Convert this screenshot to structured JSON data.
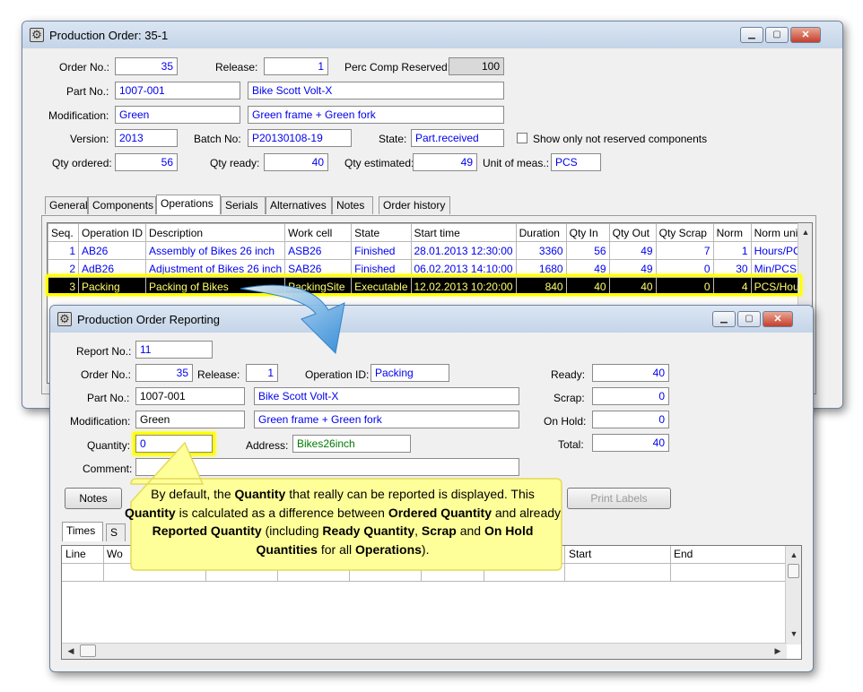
{
  "main": {
    "title": "Production Order: 35-1",
    "labels": {
      "order_no": "Order No.:",
      "release": "Release:",
      "perc_comp": "Perc Comp Reserved:",
      "part_no": "Part No.:",
      "modification": "Modification:",
      "version": "Version:",
      "batch_no": "Batch No:",
      "state": "State:",
      "show_only": "Show only not reserved components",
      "qty_ordered": "Qty ordered:",
      "qty_ready": "Qty ready:",
      "qty_estimated": "Qty estimated:",
      "unit": "Unit of meas.:"
    },
    "values": {
      "order_no": "35",
      "release": "1",
      "perc_comp": "100",
      "part_no": "1007-001",
      "part_desc": "Bike Scott Volt-X",
      "modification": "Green",
      "modification_desc": "Green frame + Green fork",
      "version": "2013",
      "batch_no": "P20130108-19",
      "state": "Part.received",
      "qty_ordered": "56",
      "qty_ready": "40",
      "qty_estimated": "49",
      "unit": "PCS"
    },
    "tabs": [
      "General",
      "Components",
      "Operations",
      "Serials",
      "Alternatives",
      "Notes",
      "Order history"
    ],
    "active_tab": "Operations",
    "columns": [
      "Seq.",
      "Operation ID",
      "Description",
      "Work cell",
      "State",
      "Start time",
      "Duration",
      "Qty In",
      "Qty Out",
      "Qty Scrap",
      "Norm",
      "Norm unit"
    ],
    "rows": [
      [
        "1",
        "AB26",
        "Assembly of Bikes 26 inch",
        "ASB26",
        "Finished",
        "28.01.2013 12:30:00",
        "3360",
        "56",
        "49",
        "7",
        "1",
        "Hours/PCS"
      ],
      [
        "2",
        "AdB26",
        "Adjustment of Bikes 26 inch",
        "SAB26",
        "Finished",
        "06.02.2013 14:10:00",
        "1680",
        "49",
        "49",
        "0",
        "30",
        "Min/PCS"
      ],
      [
        "3",
        "Packing",
        "Packing of Bikes",
        "PackingSite",
        "Executable",
        "12.02.2013 10:20:00",
        "840",
        "40",
        "40",
        "0",
        "4",
        "PCS/Hour"
      ]
    ]
  },
  "report": {
    "title": "Production Order Reporting",
    "labels": {
      "report_no": "Report No.:",
      "order_no": "Order No.:",
      "release": "Release:",
      "operation_id": "Operation ID:",
      "part_no": "Part No.:",
      "modification": "Modification:",
      "quantity": "Quantity:",
      "address": "Address:",
      "comment": "Comment:",
      "ready": "Ready:",
      "scrap": "Scrap:",
      "on_hold": "On Hold:",
      "total": "Total:"
    },
    "values": {
      "report_no": "11",
      "order_no": "35",
      "release": "1",
      "operation_id": "Packing",
      "part_no": "1007-001",
      "part_desc": "Bike Scott Volt-X",
      "modification": "Green",
      "modification_desc": "Green frame + Green fork",
      "quantity": "0",
      "address": "Bikes26inch",
      "comment": "",
      "ready": "40",
      "scrap": "0",
      "on_hold": "0",
      "total": "40"
    },
    "buttons": {
      "notes": "Notes",
      "print_labels": "Print Labels"
    },
    "tabs": [
      "Times",
      "S"
    ],
    "columns": [
      "Line",
      "Wo",
      "Start",
      "End"
    ]
  },
  "callout": {
    "t1": "By default, the ",
    "b1": "Quantity",
    "t2": " that really can be reported is displayed. This ",
    "b2": "Quantity",
    "t3": " is calculated as a difference between ",
    "b3": "Ordered Quantity",
    "t4": " and already ",
    "b4": "Reported Quantity",
    "t5": " (including ",
    "b5": "Ready Quantity",
    "t6": ", ",
    "b6": "Scrap",
    "t7": " and ",
    "b7": "On Hold Quantities",
    "t8": " for all ",
    "b8": "Operations",
    "t9": ")."
  },
  "colors": {
    "highlight": "#ffff00",
    "callout_bg": "#ffff99",
    "arrow": "#3a9be0",
    "link_text": "#0000ee"
  }
}
